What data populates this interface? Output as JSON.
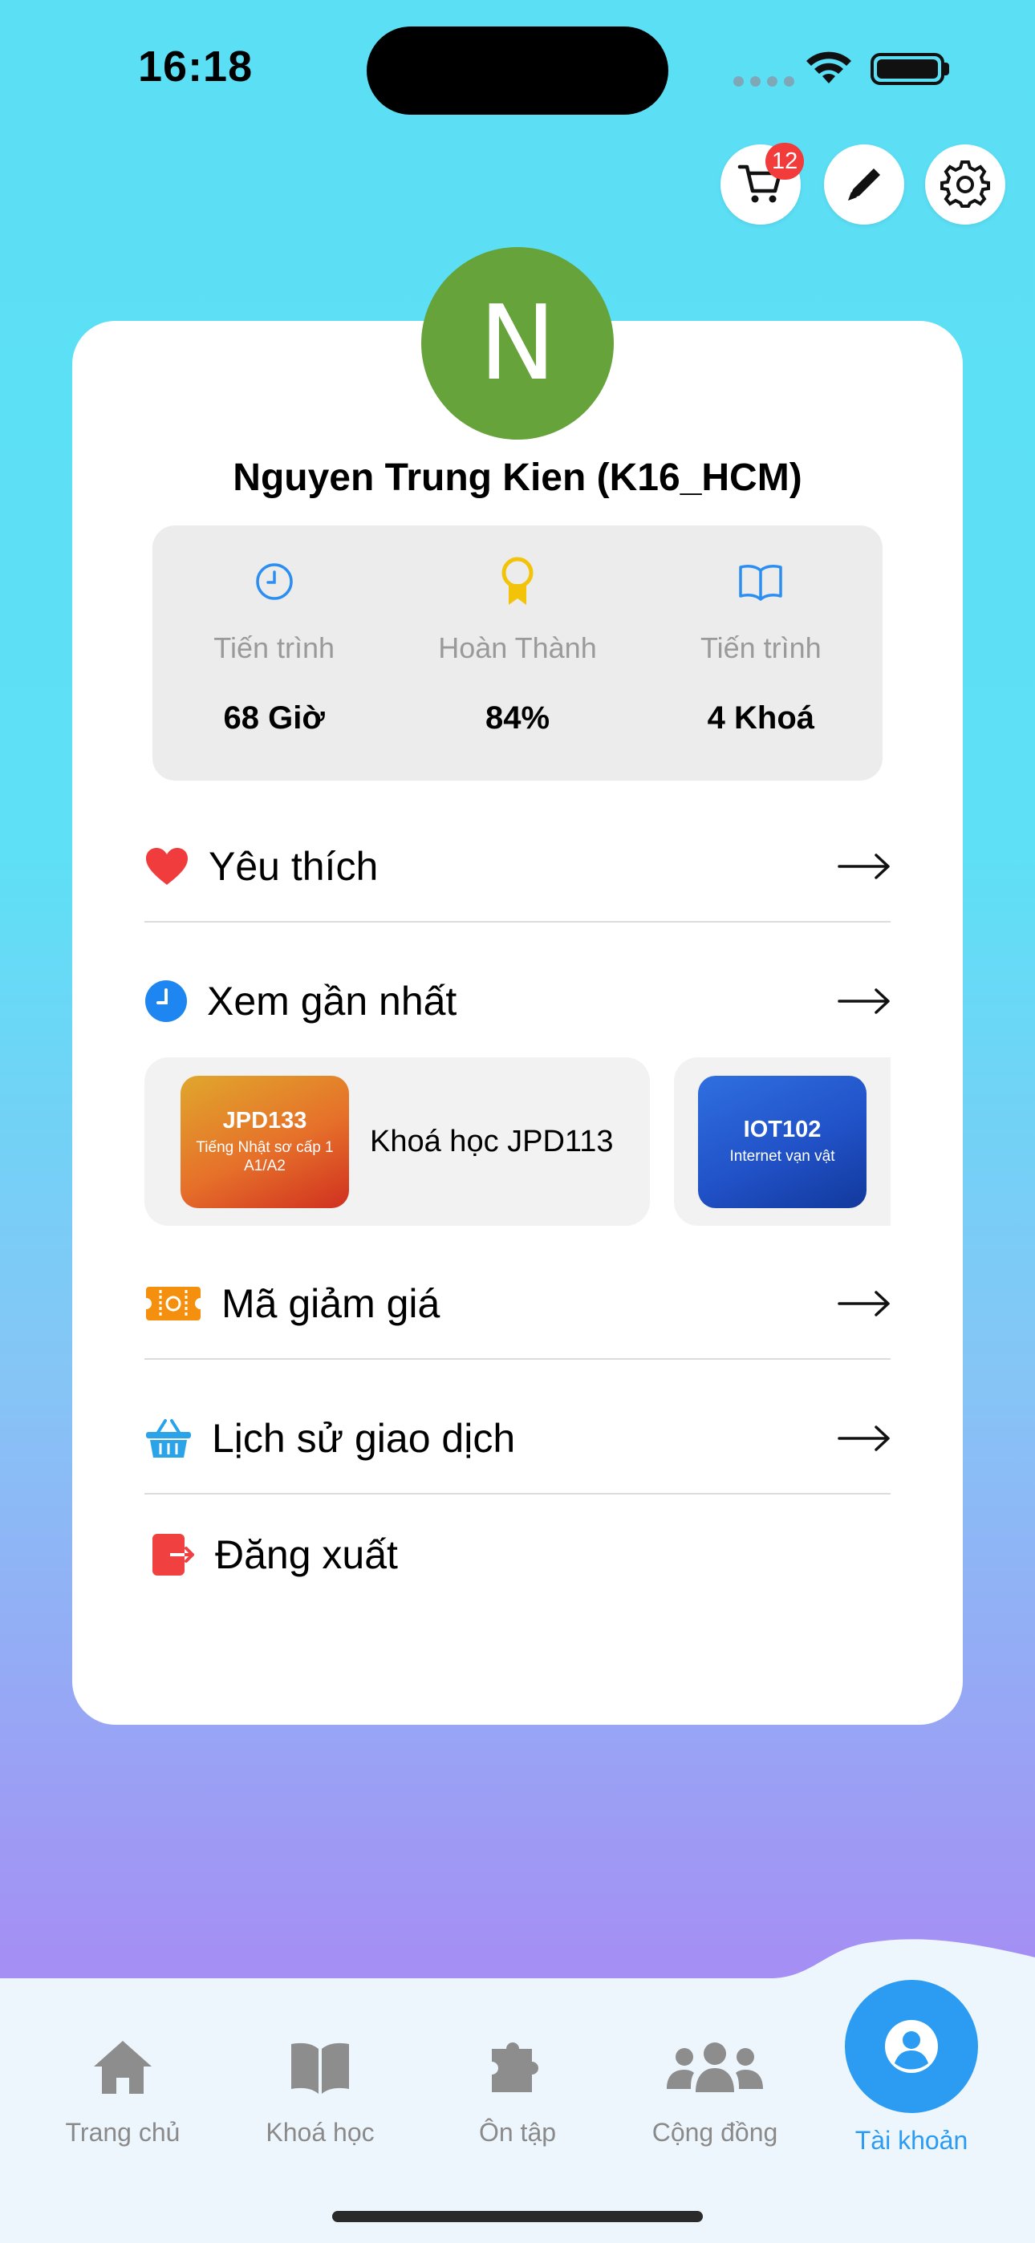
{
  "status_bar": {
    "time": "16:18"
  },
  "top_actions": {
    "cart_badge": "12"
  },
  "profile": {
    "avatar_letter": "N",
    "avatar_color": "#66a33a",
    "name": "Nguyen Trung Kien (K16_HCM)"
  },
  "stats": [
    {
      "icon": "clock-icon",
      "label": "Tiến trình",
      "value": "68 Giờ"
    },
    {
      "icon": "award-icon",
      "label": "Hoàn Thành",
      "value": "84%"
    },
    {
      "icon": "book-icon",
      "label": "Tiến trình",
      "value": "4 Khoá"
    }
  ],
  "menu": {
    "favorites": "Yêu thích",
    "recent": "Xem gần nhất",
    "coupons": "Mã giảm giá",
    "transactions": "Lịch sử giao dịch",
    "logout": "Đăng xuất"
  },
  "recent_courses": [
    {
      "code": "JPD133",
      "subtitle": "Tiếng Nhật sơ cấp 1 A1/A2",
      "title": "Khoá học JPD113"
    },
    {
      "code": "IOT102",
      "subtitle": "Internet vạn vật",
      "title": ""
    }
  ],
  "bottom_nav": {
    "home": "Trang chủ",
    "courses": "Khoá học",
    "review": "Ôn tập",
    "community": "Cộng đồng",
    "account": "Tài khoản"
  },
  "colors": {
    "accent": "#2b9cf2",
    "favorite": "#f03c3c",
    "badge": "#f23b3b"
  }
}
